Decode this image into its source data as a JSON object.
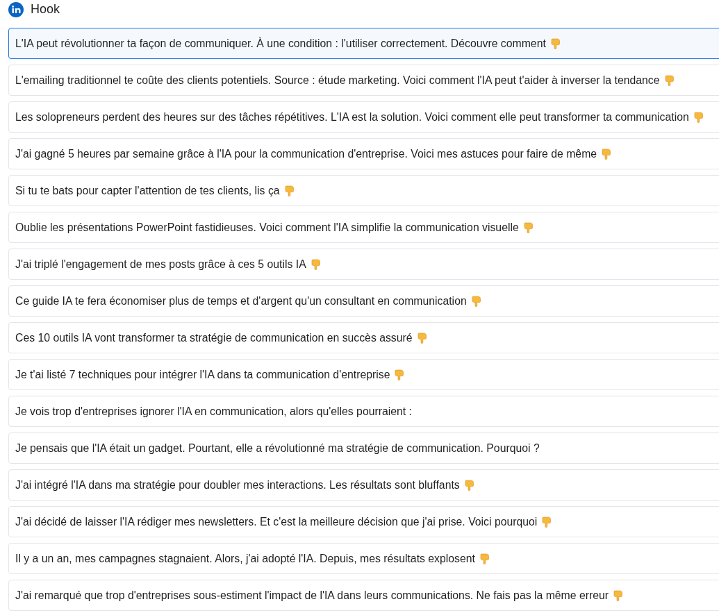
{
  "header": {
    "title": "Hook"
  },
  "hooks": [
    {
      "text": "L'IA peut révolutionner ta façon de communiquer. À une condition : l'utiliser correctement. Découvre comment",
      "pointer": true,
      "selected": true
    },
    {
      "text": "L'emailing traditionnel te coûte des clients potentiels. Source : étude marketing. Voici comment l'IA peut t'aider à inverser la tendance",
      "pointer": true,
      "selected": false
    },
    {
      "text": "Les solopreneurs perdent des heures sur des tâches répétitives. L'IA est la solution. Voici comment elle peut transformer ta communication",
      "pointer": true,
      "selected": false
    },
    {
      "text": "J'ai gagné 5 heures par semaine grâce à l'IA pour la communication d'entreprise. Voici mes astuces pour faire de même",
      "pointer": true,
      "selected": false
    },
    {
      "text": "Si tu te bats pour capter l'attention de tes clients, lis ça",
      "pointer": true,
      "selected": false
    },
    {
      "text": "Oublie les présentations PowerPoint fastidieuses. Voici comment l'IA simplifie la communication visuelle",
      "pointer": true,
      "selected": false
    },
    {
      "text": "J'ai triplé l'engagement de mes posts grâce à ces 5 outils IA",
      "pointer": true,
      "selected": false
    },
    {
      "text": "Ce guide IA te fera économiser plus de temps et d'argent qu'un consultant en communication",
      "pointer": true,
      "selected": false
    },
    {
      "text": "Ces 10 outils IA vont transformer ta stratégie de communication en succès assuré",
      "pointer": true,
      "selected": false
    },
    {
      "text": "Je t'ai listé 7 techniques pour intégrer l'IA dans ta communication d'entreprise",
      "pointer": true,
      "selected": false
    },
    {
      "text": "Je vois trop d'entreprises ignorer l'IA en communication, alors qu'elles pourraient :",
      "pointer": false,
      "selected": false
    },
    {
      "text": "Je pensais que l'IA était un gadget. Pourtant, elle a révolutionné ma stratégie de communication. Pourquoi ?",
      "pointer": false,
      "selected": false
    },
    {
      "text": "J'ai intégré l'IA dans ma stratégie pour doubler mes interactions. Les résultats sont bluffants",
      "pointer": true,
      "selected": false
    },
    {
      "text": "J'ai décidé de laisser l'IA rédiger mes newsletters. Et c'est la meilleure décision que j'ai prise. Voici pourquoi",
      "pointer": true,
      "selected": false
    },
    {
      "text": "Il y a un an, mes campagnes stagnaient. Alors, j'ai adopté l'IA. Depuis, mes résultats explosent",
      "pointer": true,
      "selected": false
    },
    {
      "text": "J'ai remarqué que trop d'entreprises sous-estiment l'impact de l'IA dans leurs communications. Ne fais pas la même erreur",
      "pointer": true,
      "selected": false
    }
  ]
}
